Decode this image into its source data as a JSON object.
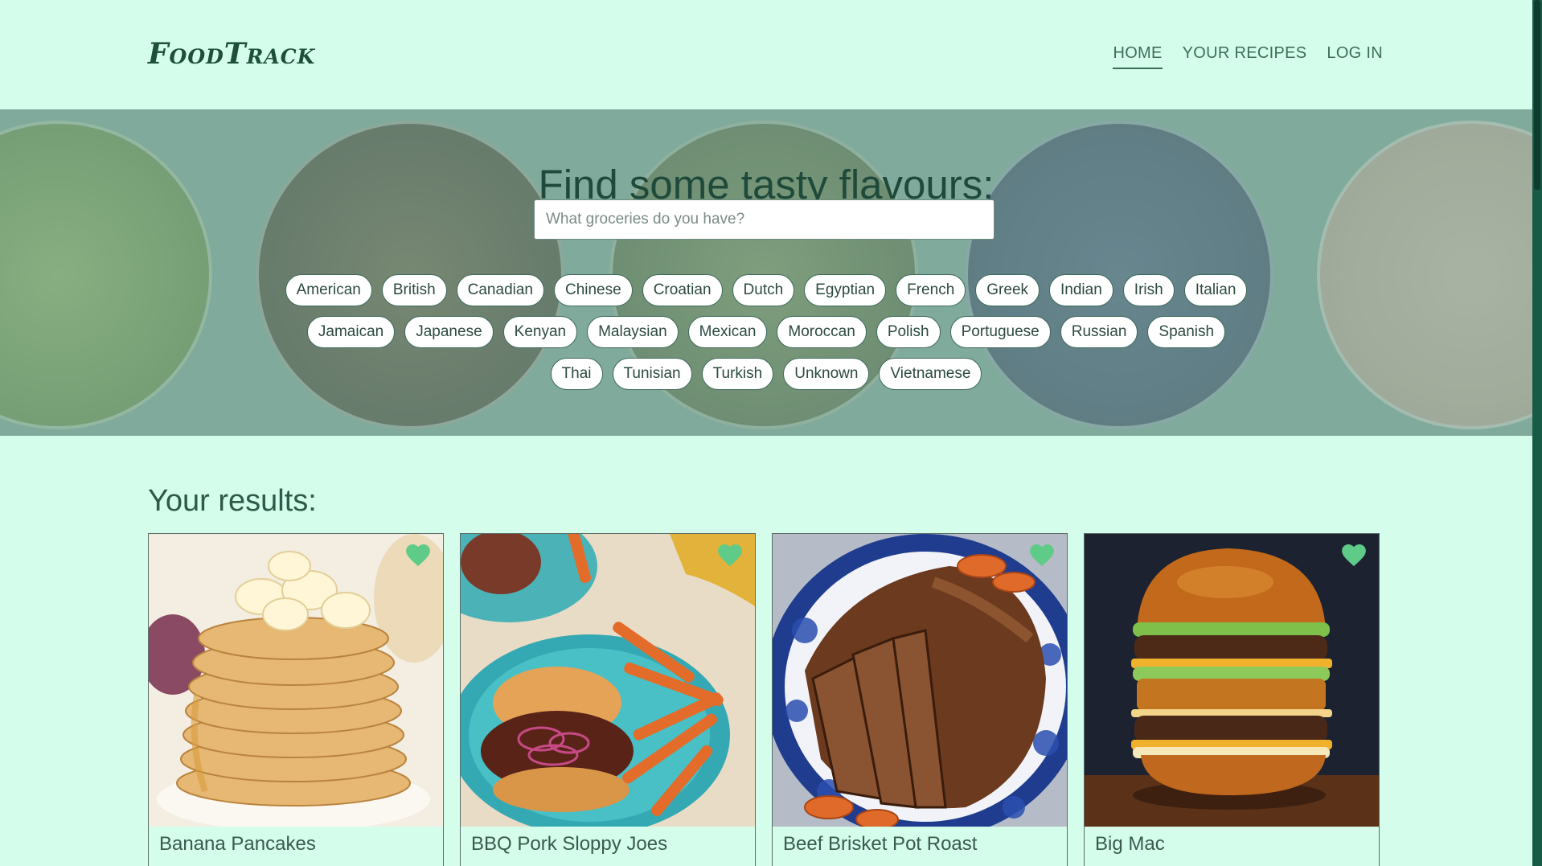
{
  "brand": {
    "logo_text": "FoodTrack"
  },
  "nav": {
    "items": [
      {
        "label": "HOME",
        "active": true
      },
      {
        "label": "YOUR RECIPES",
        "active": false
      },
      {
        "label": "LOG IN",
        "active": false
      }
    ]
  },
  "hero": {
    "title": "Find some tasty flavours:",
    "search_placeholder": "What groceries do you have?",
    "search_value": ""
  },
  "cuisines": {
    "row1": [
      "American",
      "British",
      "Canadian",
      "Chinese",
      "Croatian",
      "Dutch",
      "Egyptian",
      "French",
      "Greek",
      "Indian",
      "Irish",
      "Italian"
    ],
    "row2": [
      "Jamaican",
      "Japanese",
      "Kenyan",
      "Malaysian",
      "Mexican",
      "Moroccan",
      "Polish",
      "Portuguese",
      "Russian",
      "Spanish"
    ],
    "row3": [
      "Thai",
      "Tunisian",
      "Turkish",
      "Unknown",
      "Vietnamese"
    ]
  },
  "results": {
    "title": "Your results:",
    "cards": [
      {
        "title": "Banana Pancakes",
        "image": "banana-pancakes-photo",
        "favorite_icon": "heart-icon"
      },
      {
        "title": "BBQ Pork Sloppy Joes",
        "image": "bbq-pork-sloppy-joes-photo",
        "favorite_icon": "heart-icon"
      },
      {
        "title": "Beef Brisket Pot Roast",
        "image": "beef-brisket-pot-roast-photo",
        "favorite_icon": "heart-icon"
      },
      {
        "title": "Big Mac",
        "image": "big-mac-photo",
        "favorite_icon": "heart-icon"
      }
    ]
  },
  "colors": {
    "page_bg": "#d4fdec",
    "text_dark": "#1f4a3b",
    "heart": "#5fcb88",
    "scrollbar": "#175b47"
  }
}
